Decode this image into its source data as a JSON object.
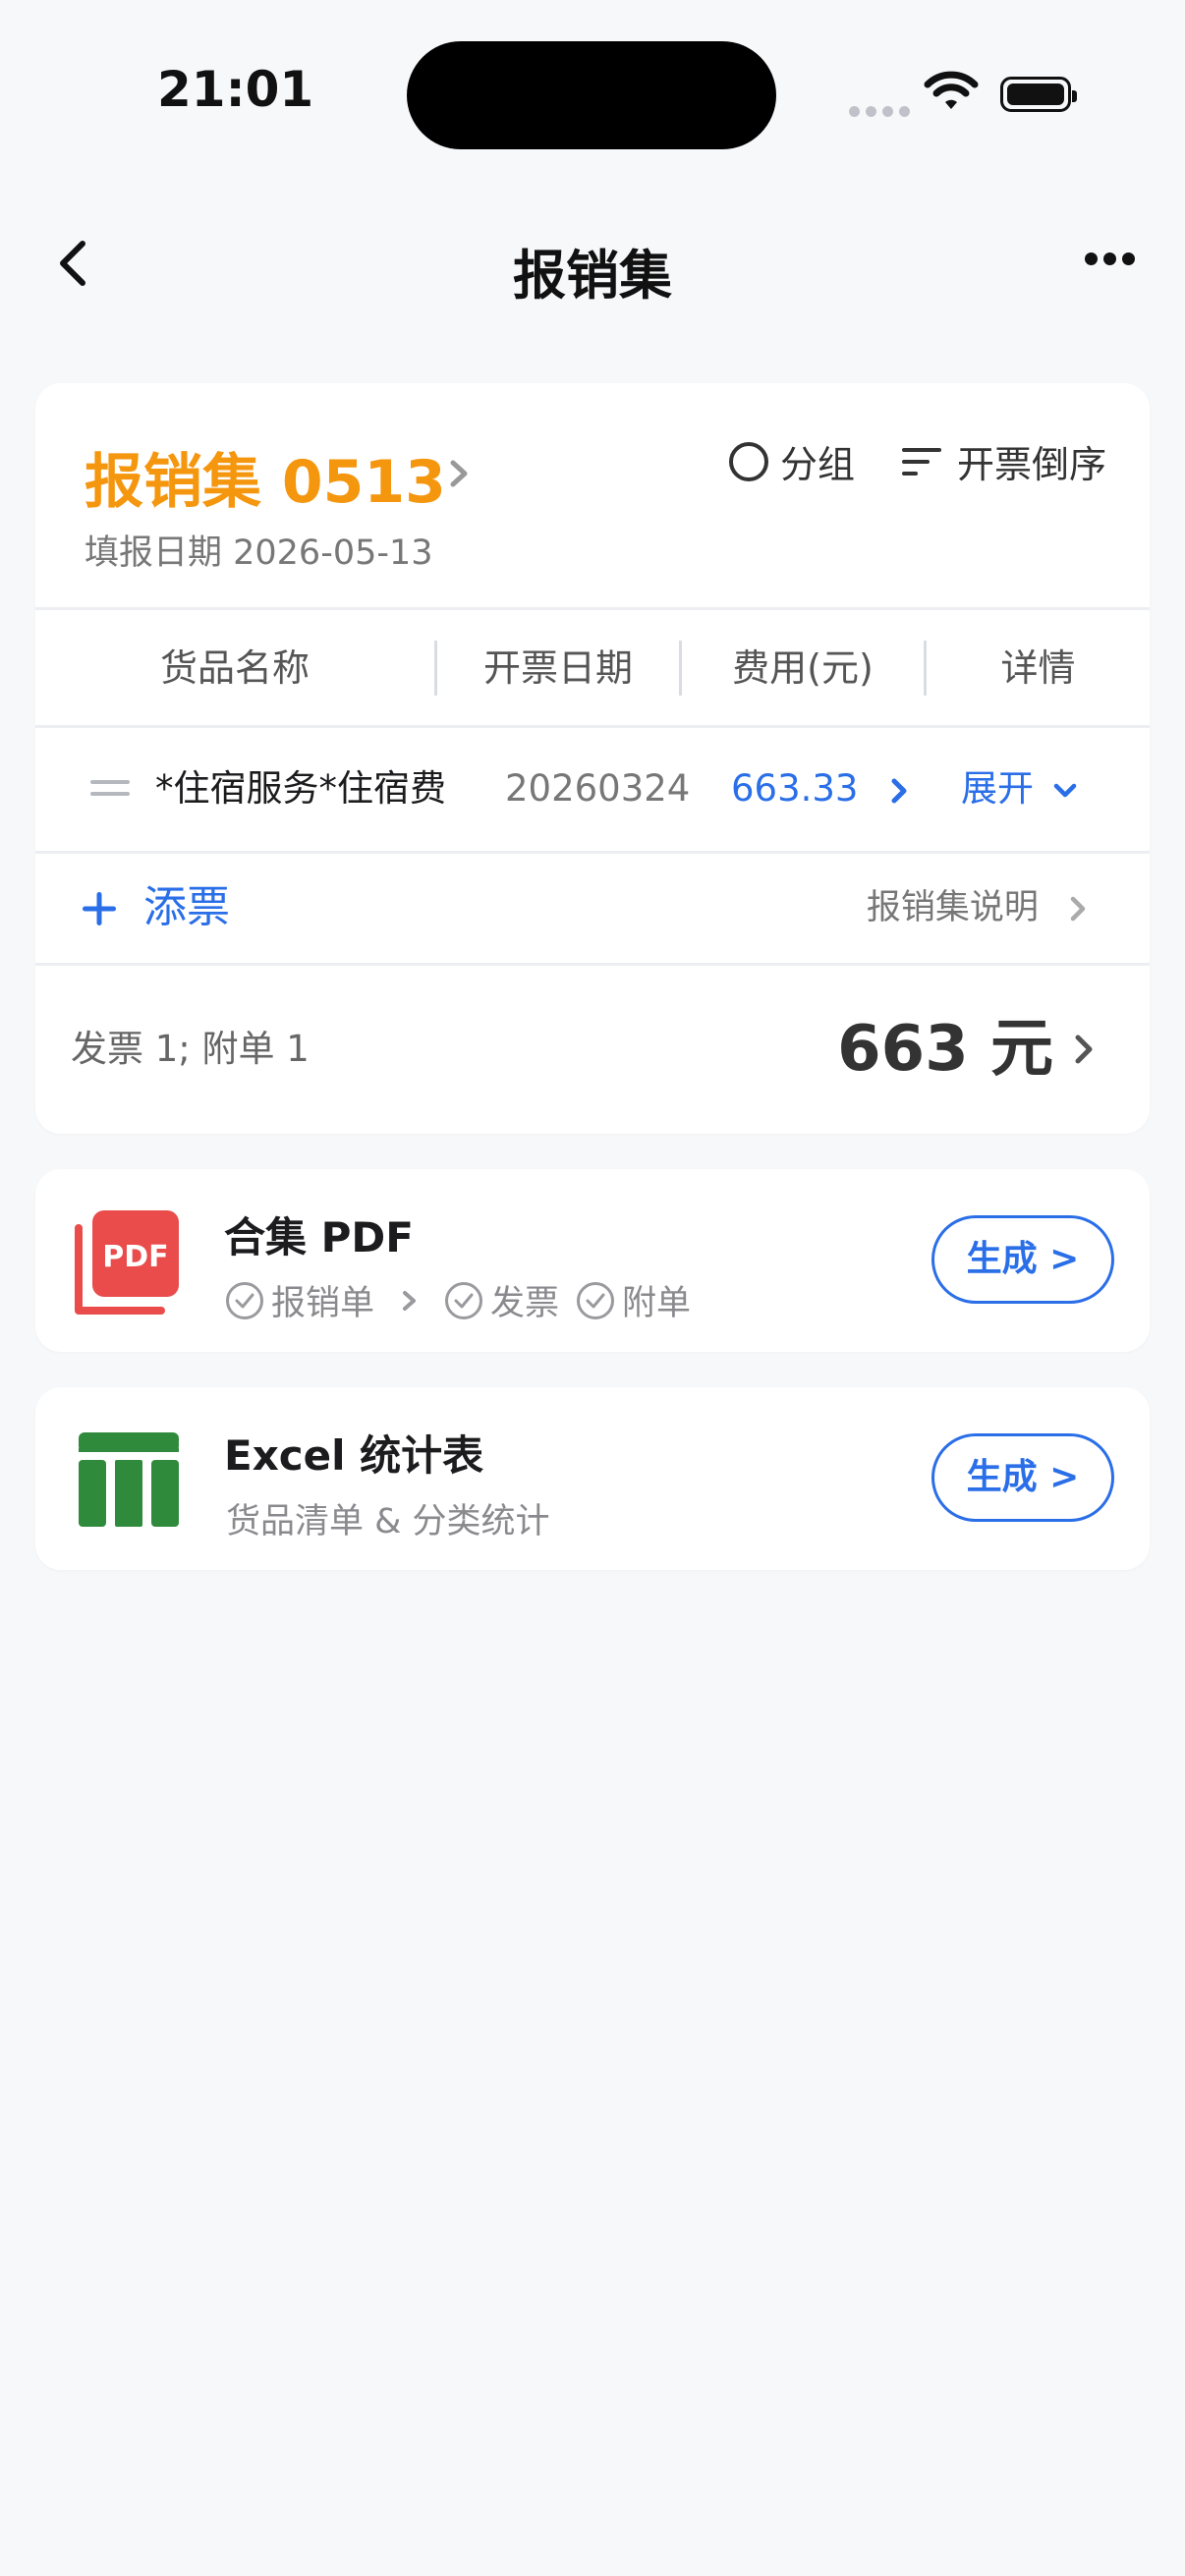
{
  "status_bar": {
    "time": "21:01"
  },
  "nav": {
    "title": "报销集"
  },
  "set": {
    "title": "报销集 0513",
    "fill_date": "填报日期 2026-05-13",
    "group_label": "分组",
    "sort_label": "开票倒序"
  },
  "table": {
    "headers": [
      "货品名称",
      "开票日期",
      "费用(元)",
      "详情"
    ],
    "rows": [
      {
        "name": "*住宿服务*住宿费",
        "date": "20260324",
        "amount": "663.33",
        "detail": "展开"
      }
    ]
  },
  "actions": {
    "add_label": "添票",
    "explain_label": "报销集说明"
  },
  "summary": {
    "counts": "发票 1; 附单 1",
    "total": "663 元"
  },
  "exports": [
    {
      "title": "合集 PDF",
      "icon": "pdf-icon",
      "icon_text": "PDF",
      "checks": [
        "报销单",
        "发票",
        "附单"
      ],
      "button": "生成 >"
    },
    {
      "title": "Excel 统计表",
      "icon": "excel-table-icon",
      "subtitle": "货品清单 & 分类统计",
      "button": "生成 >"
    }
  ],
  "colors": {
    "accent": "#2a6ee8",
    "title_orange": "#f5960f",
    "pdf_red": "#ea4b4b",
    "excel_green": "#2f8a3c"
  }
}
